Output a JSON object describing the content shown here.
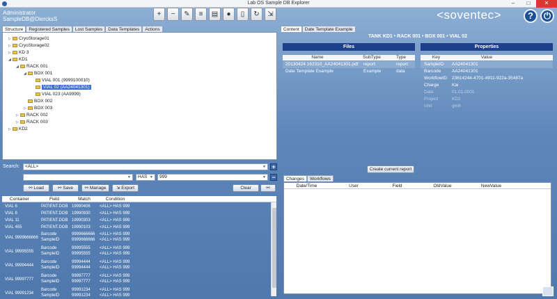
{
  "window": {
    "title": "Lab OS Sample DB Explorer",
    "minimize": "–",
    "maximize": "□",
    "close": "✕"
  },
  "header": {
    "user": "Administrator",
    "db": "SampleDB@DiercksS",
    "brand": "<soventec>",
    "help": "?",
    "power": "⏻"
  },
  "toolbar": [
    "add-icon",
    "remove-icon",
    "edit-icon",
    "multi-edit-icon",
    "table-icon",
    "users-icon",
    "clipboard-icon",
    "refresh-icon",
    "export-icon"
  ],
  "left_tabs": [
    "Structure",
    "Registered Samples",
    "Lost Samples",
    "Data Templates",
    "Actions"
  ],
  "tree": [
    {
      "label": "CryoStorage01",
      "level": 0,
      "expanded": false
    },
    {
      "label": "CryoStorage02",
      "level": 0,
      "expanded": false
    },
    {
      "label": "KD 3",
      "level": 0,
      "expanded": false
    },
    {
      "label": "KD1",
      "level": 0,
      "expanded": true
    },
    {
      "label": "RACK 001",
      "level": 1,
      "expanded": true
    },
    {
      "label": "BOX 001",
      "level": 2,
      "expanded": true
    },
    {
      "label": "VIAL 001 (9999100010)",
      "level": 3,
      "expanded": null
    },
    {
      "label": "VIAL 02 (AA24041301)",
      "level": 3,
      "expanded": null,
      "selected": true
    },
    {
      "label": "VIAL 023 (AA9999)",
      "level": 3,
      "expanded": null
    },
    {
      "label": "BOX 002",
      "level": 2,
      "expanded": null
    },
    {
      "label": "BOX 003",
      "level": 2,
      "expanded": false
    },
    {
      "label": "RACK 002",
      "level": 1,
      "expanded": false
    },
    {
      "label": "RACK 003",
      "level": 1,
      "expanded": false
    },
    {
      "label": "KD2",
      "level": 0,
      "expanded": false
    }
  ],
  "search": {
    "label": "Search:",
    "scope": "<ALL>",
    "field": "",
    "operator": "HAS",
    "value": "999",
    "buttons": {
      "load": "Load",
      "save": "Save",
      "manage": "Manage",
      "export": "Export",
      "clear": "Clear"
    }
  },
  "results": {
    "columns": [
      "Container",
      "Field",
      "Match",
      "Condition"
    ],
    "rows": [
      {
        "c": "VIAL 6",
        "f": [
          "PATIENT.DOB"
        ],
        "m": [
          "19990406"
        ],
        "k": [
          "<ALL> HAS 999"
        ]
      },
      {
        "c": "VIAL 8",
        "f": [
          "PATIENT.DOB"
        ],
        "m": [
          "19990930"
        ],
        "k": [
          "<ALL> HAS 999"
        ]
      },
      {
        "c": "VIAL 11",
        "f": [
          "PATIENT.DOB"
        ],
        "m": [
          "19990303"
        ],
        "k": [
          "<ALL> HAS 999"
        ]
      },
      {
        "c": "VIAL 455",
        "f": [
          "PATIENT.DOB"
        ],
        "m": [
          "19990103"
        ],
        "k": [
          "<ALL> HAS 999"
        ]
      },
      {
        "c": "VIAL 9999666666",
        "f": [
          "Barcode",
          "SampleID"
        ],
        "m": [
          "9999666666",
          "9999666666"
        ],
        "k": [
          "<ALL> HAS 999",
          "<ALL> HAS 999"
        ]
      },
      {
        "c": "VIAL 99995555",
        "f": [
          "Barcode",
          "SampleID"
        ],
        "m": [
          "99995555",
          "99995555"
        ],
        "k": [
          "<ALL> HAS 999",
          "<ALL> HAS 999"
        ]
      },
      {
        "c": "VIAL 99994444",
        "f": [
          "Barcode",
          "SampleID"
        ],
        "m": [
          "99994444",
          "99994444"
        ],
        "k": [
          "<ALL> HAS 999",
          "<ALL> HAS 999"
        ]
      },
      {
        "c": "VIAL 99997777",
        "f": [
          "Barcode",
          "SampleID"
        ],
        "m": [
          "99997777",
          "99997777"
        ],
        "k": [
          "<ALL> HAS 999",
          "<ALL> HAS 999"
        ]
      },
      {
        "c": "VIAL 99991234",
        "f": [
          "Barcode",
          "SampleID"
        ],
        "m": [
          "99991234",
          "99991234"
        ],
        "k": [
          "<ALL> HAS 999",
          "<ALL> HAS 999"
        ]
      }
    ]
  },
  "right_tabs": [
    "Content",
    "Date Template Example"
  ],
  "breadcrumb": "TANK KD1 • RACK 001 • BOX 001 • VIAL 02",
  "files": {
    "heading": "Files",
    "columns": [
      "Name",
      "SubType",
      "Type"
    ],
    "rows": [
      {
        "name": "20130424 162310_AA24041301.pdf",
        "subtype": "report",
        "type": "report"
      },
      {
        "name": "Date Template Example",
        "subtype": "Example",
        "type": "data"
      }
    ]
  },
  "properties": {
    "heading": "Properties",
    "columns": [
      "Key",
      "Value"
    ],
    "rows": [
      {
        "key": "SampleID",
        "value": "AA24041301",
        "faded": false
      },
      {
        "key": "Barcode",
        "value": "AA24041301",
        "faded": false
      },
      {
        "key": "WorkflowID",
        "value": "23614244-4701-4911-922a-35487a",
        "faded": false
      },
      {
        "key": "Charge",
        "value": "Kai",
        "faded": false
      },
      {
        "key": "Date",
        "value": "01.01.0001",
        "faded": true
      },
      {
        "key": "Project",
        "value": "KD2",
        "faded": true
      },
      {
        "key": "Unit",
        "value": "gm8",
        "faded": true
      }
    ]
  },
  "create_report": "Create current report",
  "bottom_tabs": [
    "Changes",
    "Workflows"
  ],
  "changes": {
    "columns": [
      "Date/Time",
      "User",
      "Field",
      "OldValue",
      "NewValue"
    ]
  }
}
